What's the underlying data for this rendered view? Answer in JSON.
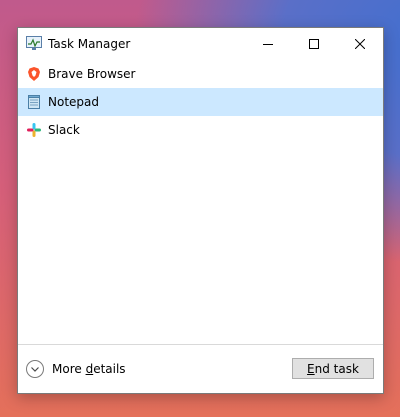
{
  "window": {
    "title": "Task Manager",
    "title_icon": "task-manager-icon"
  },
  "apps": [
    {
      "label": "Brave Browser",
      "icon": "brave-icon",
      "selected": false
    },
    {
      "label": "Notepad",
      "icon": "notepad-icon",
      "selected": true
    },
    {
      "label": "Slack",
      "icon": "slack-icon",
      "selected": false
    }
  ],
  "footer": {
    "more_details_prefix": "More ",
    "more_details_accel": "d",
    "more_details_suffix": "etails",
    "end_task_accel": "E",
    "end_task_suffix": "nd task"
  },
  "colors": {
    "selected_row": "#cce8ff",
    "button_bg": "#e1e1e1"
  }
}
